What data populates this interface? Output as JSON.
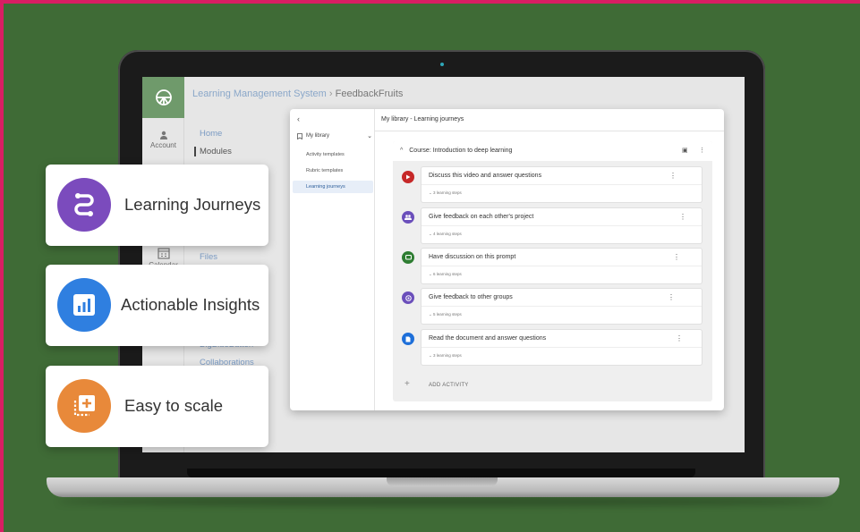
{
  "lms": {
    "breadcrumb_app": "Learning Management System",
    "breadcrumb_sep": "›",
    "breadcrumb_current": "FeedbackFruits",
    "rail": {
      "account": "Account",
      "calendar": "Calendar"
    },
    "nav": {
      "home": "Home",
      "modules": "Modules",
      "files": "Files",
      "bigbluebutton": "BigBlueButton",
      "collaborations": "Collaborations"
    }
  },
  "modal": {
    "back": "‹",
    "library_label": "My library",
    "library_items": [
      "Activity templates",
      "Rubric templates",
      "Learning journeys"
    ],
    "header": "My library - Learning journeys",
    "course_title": "Course: Introduction to deep learning",
    "activities": [
      {
        "title": "Discuss this video and answer questions",
        "steps": "3 learning steps",
        "color": "#c62828",
        "icon": "play-icon"
      },
      {
        "title": "Give feedback on each other's project",
        "steps": "4 learning steps",
        "color": "#6b4fbb",
        "icon": "group-icon"
      },
      {
        "title": "Have discussion on this prompt",
        "steps": "6 learning steps",
        "color": "#2e7d32",
        "icon": "chat-icon"
      },
      {
        "title": "Give feedback to other groups",
        "steps": "5 learning steps",
        "color": "#6b4fbb",
        "icon": "groups-icon"
      },
      {
        "title": "Read the document and answer questions",
        "steps": "3 learning steps",
        "color": "#1e6fd9",
        "icon": "document-icon"
      }
    ],
    "add_activity": "ADD ACTIVITY"
  },
  "cards": [
    {
      "label": "Learning Journeys",
      "color": "#7b4bbd",
      "icon": "route-icon"
    },
    {
      "label": "Actionable Insights",
      "color": "#2f7fe0",
      "icon": "bar-chart-icon"
    },
    {
      "label": "Easy to scale",
      "color": "#e8893a",
      "icon": "add-copy-icon"
    }
  ],
  "colors": {
    "border": "#d81e63",
    "background": "#3f6b36",
    "lms_logo": "#6f9a6b",
    "link": "#7b9bc3"
  }
}
